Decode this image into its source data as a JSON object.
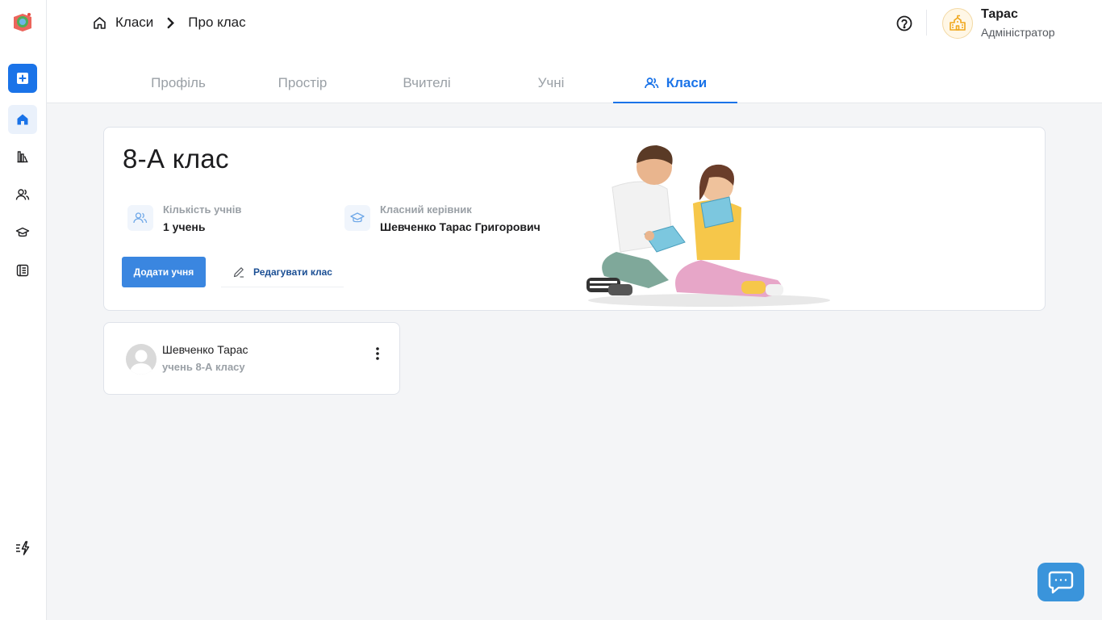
{
  "breadcrumb": {
    "items": [
      "Класи",
      "Про клас"
    ]
  },
  "user": {
    "name": "Тарас",
    "role": "Адміністратор"
  },
  "tabs": [
    {
      "label": "Профіль",
      "active": false
    },
    {
      "label": "Простір",
      "active": false
    },
    {
      "label": "Вчителі",
      "active": false
    },
    {
      "label": "Учні",
      "active": false
    },
    {
      "label": "Класи",
      "active": true
    }
  ],
  "class_card": {
    "title": "8-А клас",
    "stats": [
      {
        "label": "Кількість учнів",
        "value": "1 учень"
      },
      {
        "label": "Класний керівник",
        "value": "Шевченко Тарас Григорович"
      }
    ],
    "add_student_label": "Додати учня",
    "edit_class_label": "Редагувати клас"
  },
  "students": [
    {
      "name": "Шевченко Тарас",
      "subtitle": "учень 8-А класу"
    }
  ],
  "colors": {
    "accent": "#1a73e8",
    "button": "#3a86e0",
    "chat": "#3a94db"
  }
}
